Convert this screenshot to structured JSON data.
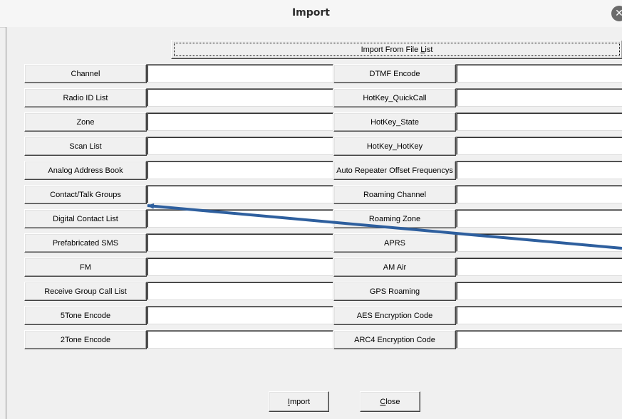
{
  "window": {
    "title": "Import",
    "close_glyph": "✕"
  },
  "import_from_file_list": {
    "label_pre": "Import From File ",
    "label_key": "L",
    "label_post": "ist"
  },
  "left_rows": [
    {
      "label": "Channel",
      "value": ""
    },
    {
      "label": "Radio ID List",
      "value": ""
    },
    {
      "label": "Zone",
      "value": ""
    },
    {
      "label": "Scan List",
      "value": ""
    },
    {
      "label": "Analog Address Book",
      "value": ""
    },
    {
      "label": "Contact/Talk Groups",
      "value": ""
    },
    {
      "label": "Digital Contact List",
      "value": ""
    },
    {
      "label": "Prefabricated SMS",
      "value": ""
    },
    {
      "label": "FM",
      "value": ""
    },
    {
      "label": "Receive Group Call List",
      "value": ""
    },
    {
      "label": "5Tone Encode",
      "value": ""
    },
    {
      "label": "2Tone Encode",
      "value": ""
    }
  ],
  "right_rows": [
    {
      "label": "DTMF Encode",
      "value": ""
    },
    {
      "label": "HotKey_QuickCall",
      "value": ""
    },
    {
      "label": "HotKey_State",
      "value": ""
    },
    {
      "label": "HotKey_HotKey",
      "value": ""
    },
    {
      "label": "Auto Repeater Offset Frequencys",
      "value": ""
    },
    {
      "label": "Roaming Channel",
      "value": ""
    },
    {
      "label": "Roaming Zone",
      "value": ""
    },
    {
      "label": "APRS",
      "value": ""
    },
    {
      "label": "AM Air",
      "value": ""
    },
    {
      "label": "GPS Roaming",
      "value": ""
    },
    {
      "label": "AES Encryption Code",
      "value": ""
    },
    {
      "label": "ARC4 Encryption Code",
      "value": ""
    }
  ],
  "footer": {
    "import": {
      "key": "I",
      "rest": "mport"
    },
    "close": {
      "key": "C",
      "rest": "lose"
    }
  },
  "annotation": {
    "arrow_color": "#2e5f9e"
  }
}
